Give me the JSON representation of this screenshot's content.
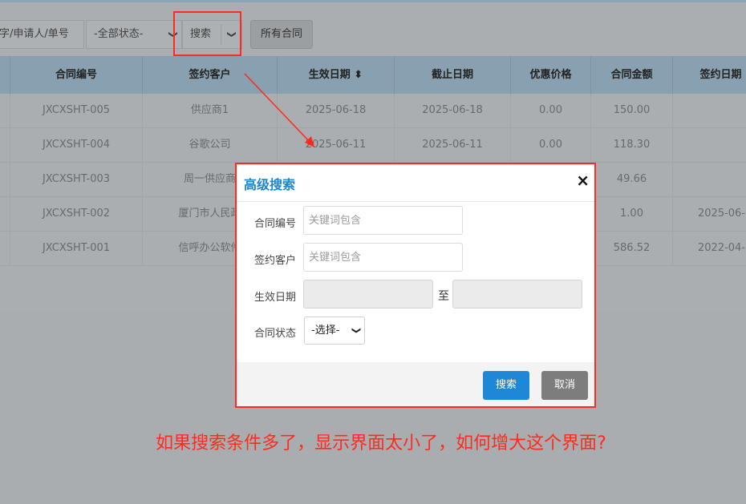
{
  "toolbar": {
    "keyword_placeholder": "字/申请人/单号",
    "status_value": "-全部状态-",
    "search_label": "搜索",
    "all_contracts_label": "所有合同"
  },
  "table": {
    "headers": [
      "合同编号",
      "签约客户",
      "生效日期 ⬍",
      "截止日期",
      "优惠价格",
      "合同金额",
      "签约日期"
    ],
    "rows": [
      [
        "JXCXSHT-005",
        "供应商1",
        "2025-06-18",
        "2025-06-18",
        "0.00",
        "150.00",
        ""
      ],
      [
        "JXCXSHT-004",
        "谷歌公司",
        "2025-06-11",
        "2025-06-11",
        "0.00",
        "118.30",
        ""
      ],
      [
        "JXCXSHT-003",
        "周一供应商",
        "",
        "",
        "",
        "49.66",
        ""
      ],
      [
        "JXCXSHT-002",
        "厦门市人民政",
        "",
        "",
        "",
        "1.00",
        "2025-06-"
      ],
      [
        "JXCXSHT-001",
        "信呼办公软件",
        "",
        "",
        "",
        "586.52",
        "2022-04-"
      ]
    ]
  },
  "modal": {
    "title": "高级搜索",
    "close": "×",
    "fields": {
      "contract_no_label": "合同编号",
      "contract_no_placeholder": "关键词包含",
      "customer_label": "签约客户",
      "customer_placeholder": "关键词包含",
      "date_label": "生效日期",
      "date_to": "至",
      "status_label": "合同状态",
      "status_value": "-选择-"
    },
    "search_button": "搜索",
    "cancel_button": "取消"
  },
  "annotation": {
    "question": "如果搜索条件多了，显示界面太小了，如何增大这个界面?"
  },
  "colors": {
    "accent": "#1e88d6",
    "annotation_red": "#ff2a1f"
  }
}
